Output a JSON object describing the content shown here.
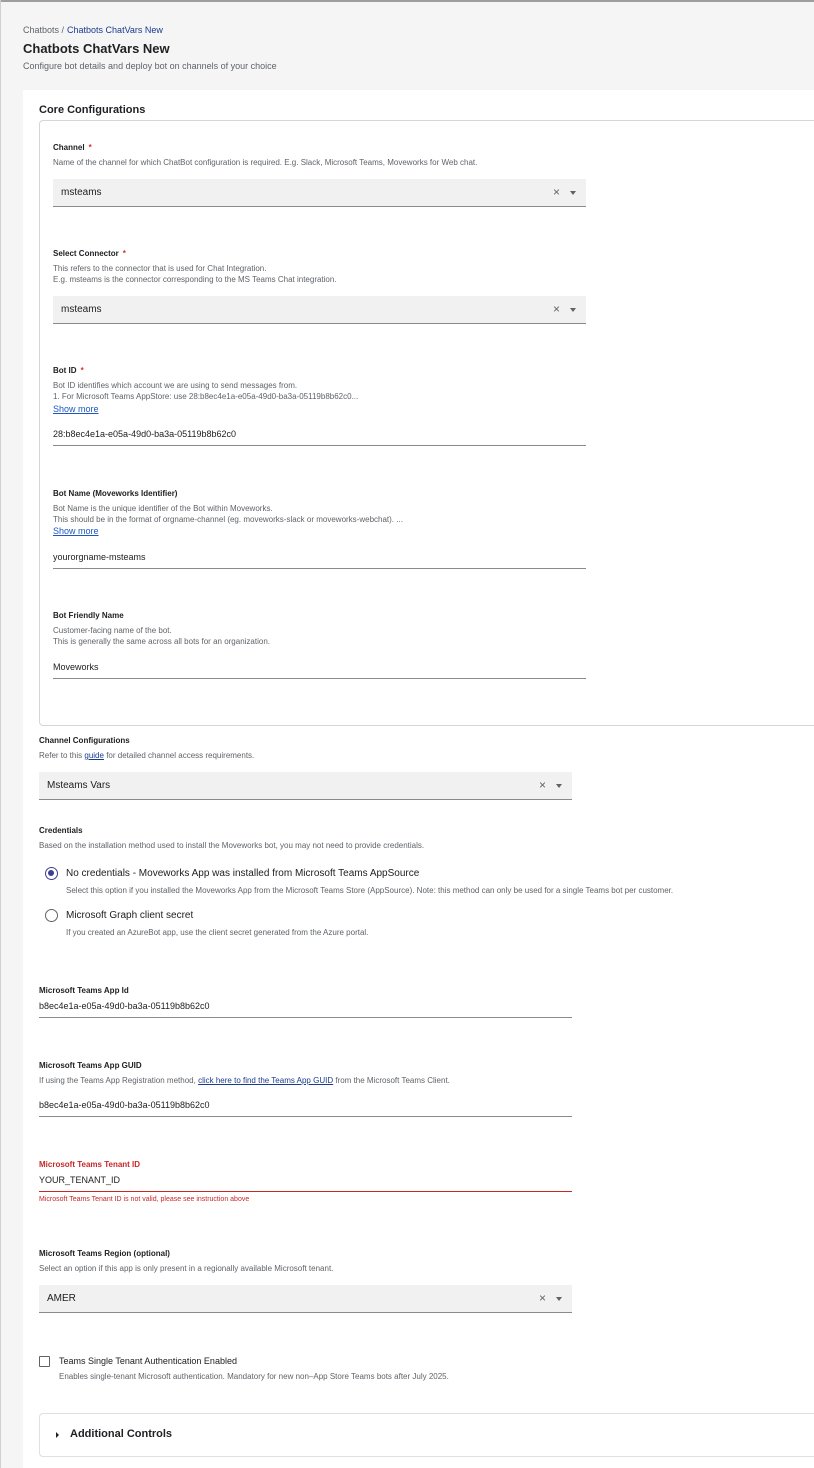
{
  "breadcrumb": {
    "parent": "Chatbots /",
    "current": "Chatbots ChatVars New"
  },
  "page": {
    "title": "Chatbots ChatVars New",
    "subtitle": "Configure bot details and deploy bot on channels of your choice"
  },
  "core": {
    "title": "Core Configurations",
    "channel": {
      "label": "Channel",
      "required": "*",
      "help": "Name of the channel for which ChatBot configuration is required. E.g. Slack, Microsoft Teams, Moveworks for Web chat.",
      "value": "msteams"
    },
    "connector": {
      "label": "Select Connector",
      "required": "*",
      "help_line1": "This refers to the connector that is used for Chat Integration.",
      "help_line2": "E.g. msteams is the connector corresponding to the MS Teams Chat integration.",
      "value": "msteams"
    },
    "bot_id": {
      "label": "Bot ID",
      "required": "*",
      "help_line1": "Bot ID identifies which account we are using to send messages from.",
      "help_line2": "1. For Microsoft Teams AppStore: use 28:b8ec4e1a-e05a-49d0-ba3a-05119b8b62c0...",
      "show_more": "Show more",
      "value": "28:b8ec4e1a-e05a-49d0-ba3a-05119b8b62c0"
    },
    "bot_name": {
      "label": "Bot Name (Moveworks Identifier)",
      "help_line1": "Bot Name is the unique identifier of the Bot within Moveworks.",
      "help_line2": "This should be in the format of orgname-channel (eg. moveworks-slack or moveworks-webchat). ...",
      "show_more": "Show more",
      "value": "yourorgname-msteams"
    },
    "friendly_name": {
      "label": "Bot Friendly Name",
      "help_line1": "Customer-facing name of the bot.",
      "help_line2": "This is generally the same across all bots for an organization.",
      "value": "Moveworks"
    }
  },
  "channel_config": {
    "label": "Channel Configurations",
    "help_pre": "Refer to this",
    "help_link": "guide",
    "help_post": "for detailed channel access requirements.",
    "value": "Msteams Vars"
  },
  "credentials": {
    "label": "Credentials",
    "help": "Based on the installation method used to install the Moveworks bot, you may not need to provide credentials.",
    "options": [
      {
        "label": "No credentials - Moveworks App was installed from Microsoft Teams AppSource",
        "help": "Select this option if you installed the Moveworks App from the Microsoft Teams Store (AppSource). Note: this method can only be used for a single Teams bot per customer."
      },
      {
        "label": "Microsoft Graph client secret",
        "help": "If you created an AzureBot app, use the client secret generated from the Azure portal."
      }
    ]
  },
  "teams_app_id": {
    "label": "Microsoft Teams App Id",
    "value": "b8ec4e1a-e05a-49d0-ba3a-05119b8b62c0"
  },
  "teams_app_guid": {
    "label": "Microsoft Teams App GUID",
    "help_pre": "If using the Teams App Registration method,",
    "help_link": "click here to find the Teams App GUID",
    "help_post": "from the Microsoft Teams Client.",
    "value": "b8ec4e1a-e05a-49d0-ba3a-05119b8b62c0"
  },
  "tenant_id": {
    "label": "Microsoft Teams Tenant ID",
    "value": "YOUR_TENANT_ID",
    "error": "Microsoft Teams Tenant ID is not valid, please see instruction above"
  },
  "region": {
    "label": "Microsoft Teams Region (optional)",
    "help": "Select an option if this app is only present in a regionally available Microsoft tenant.",
    "value": "AMER"
  },
  "single_tenant": {
    "label": "Teams Single Tenant Authentication Enabled",
    "help": "Enables single-tenant Microsoft authentication. Mandatory for new non–App Store Teams bots after July 2025."
  },
  "additional": {
    "title": "Additional Controls"
  },
  "icons": {
    "clear": "×"
  }
}
